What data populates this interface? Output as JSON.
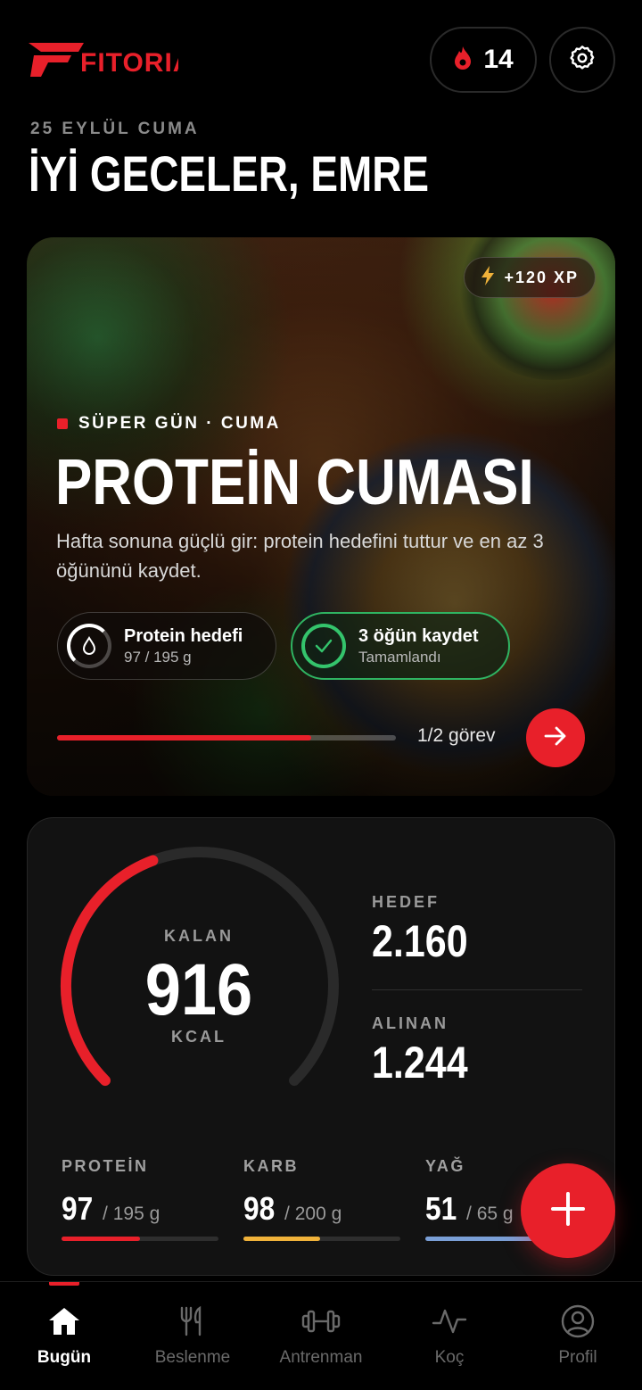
{
  "brand": {
    "logo_text": "FITORIA",
    "accent": "#e8202a"
  },
  "header": {
    "streak_count": "14",
    "streak_icon": "flame-icon",
    "settings_icon": "gear-icon"
  },
  "date_line": "25 EYLÜL CUMA",
  "greeting": "İYİ GECELER, EMRE",
  "hero": {
    "xp": "+120 XP",
    "badge": "SÜPER GÜN · CUMA",
    "title": "PROTEİN CUMASI",
    "description": "Hafta sonuna güçlü gir: protein hedefini tuttur ve en az 3 öğününü kaydet.",
    "tasks": [
      {
        "title": "Protein hedefi",
        "sub": "97 / 195 g",
        "progress": 0.5
      },
      {
        "title": "3 öğün kaydet",
        "sub": "Tamamlandı",
        "done": true
      }
    ],
    "progress_fraction": 0.75,
    "progress_label": "1/2 görev"
  },
  "calories": {
    "remaining_label": "KALAN",
    "remaining_value": "916",
    "unit": "KCAL",
    "ring_fraction": 0.424,
    "target_label": "HEDEF",
    "target_value": "2.160",
    "consumed_label": "ALINAN",
    "consumed_value": "1.244"
  },
  "macros": [
    {
      "label": "PROTEİN",
      "value": "97",
      "target": "/ 195 g",
      "fraction": 0.5,
      "color": "#e8202a"
    },
    {
      "label": "KARB",
      "value": "98",
      "target": "/ 200 g",
      "fraction": 0.49,
      "color": "#f0b23a"
    },
    {
      "label": "YAĞ",
      "value": "51",
      "target": "/ 65 g",
      "fraction": 0.78,
      "color": "#7a9fd6"
    }
  ],
  "nav": [
    {
      "label": "Bugün",
      "icon": "home-icon",
      "active": true
    },
    {
      "label": "Beslenme",
      "icon": "fork-knife-icon"
    },
    {
      "label": "Antrenman",
      "icon": "dumbbell-icon"
    },
    {
      "label": "Koç",
      "icon": "activity-icon"
    },
    {
      "label": "Profil",
      "icon": "user-icon"
    }
  ]
}
